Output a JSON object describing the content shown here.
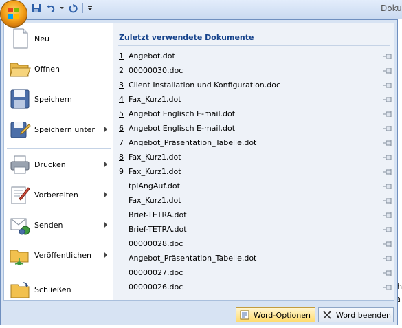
{
  "window": {
    "title": "Doku"
  },
  "quick_access": {
    "items": [
      "save-icon",
      "undo-icon",
      "redo-icon",
      "customize-icon"
    ]
  },
  "background_text": [
    "ch",
    "ta"
  ],
  "left_menu": {
    "items": [
      {
        "label": "Neu",
        "icon": "new-document-icon",
        "submenu": false
      },
      {
        "label": "Öffnen",
        "icon": "open-folder-icon",
        "submenu": false
      },
      {
        "label": "Speichern",
        "icon": "save-disk-icon",
        "submenu": false
      },
      {
        "label": "Speichern unter",
        "icon": "save-as-icon",
        "submenu": true
      },
      {
        "label": "Drucken",
        "icon": "printer-icon",
        "submenu": true
      },
      {
        "label": "Vorbereiten",
        "icon": "prepare-icon",
        "submenu": true
      },
      {
        "label": "Senden",
        "icon": "send-icon",
        "submenu": true
      },
      {
        "label": "Veröffentlichen",
        "icon": "publish-icon",
        "submenu": true
      },
      {
        "label": "Schließen",
        "icon": "close-folder-icon",
        "submenu": false
      }
    ]
  },
  "recent": {
    "title": "Zuletzt verwendete Dokumente",
    "items": [
      {
        "num": "1",
        "name": "Angebot.dot"
      },
      {
        "num": "2",
        "name": "00000030.doc"
      },
      {
        "num": "3",
        "name": "Client Installation und Konfiguration.doc"
      },
      {
        "num": "4",
        "name": "Fax_Kurz1.dot"
      },
      {
        "num": "5",
        "name": "Angebot Englisch E-mail.dot"
      },
      {
        "num": "6",
        "name": "Angebot Englisch E-mail.dot"
      },
      {
        "num": "7",
        "name": "Angebot_Präsentation_Tabelle.dot"
      },
      {
        "num": "8",
        "name": "Fax_Kurz1.dot"
      },
      {
        "num": "9",
        "name": "Fax_Kurz1.dot"
      },
      {
        "num": "",
        "name": "tplAngAuf.dot"
      },
      {
        "num": "",
        "name": "Fax_Kurz1.dot"
      },
      {
        "num": "",
        "name": "Brief-TETRA.dot"
      },
      {
        "num": "",
        "name": "Brief-TETRA.dot"
      },
      {
        "num": "",
        "name": "00000028.doc"
      },
      {
        "num": "",
        "name": "Angebot_Präsentation_Tabelle.dot"
      },
      {
        "num": "",
        "name": "00000027.doc"
      },
      {
        "num": "",
        "name": "00000026.doc"
      }
    ]
  },
  "buttons": {
    "options_label": "Word-Optionen",
    "exit_label": "Word beenden"
  },
  "colors": {
    "accent": "#15428b",
    "menu_bg": "#d7e3f3",
    "recent_bg": "#eef2f8"
  }
}
